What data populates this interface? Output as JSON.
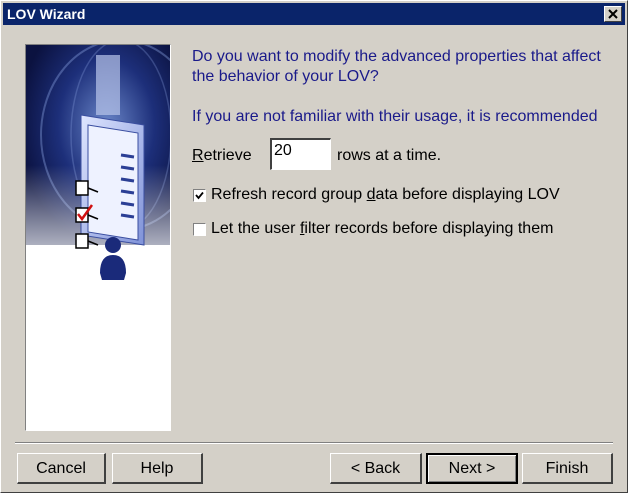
{
  "window": {
    "title": "LOV Wizard"
  },
  "question": {
    "line1": "Do you want to modify the advanced properties that affect the behavior of your LOV?",
    "line2": "If you are not familiar with their usage, it is recommended"
  },
  "retrieve": {
    "label_mnemonic": "R",
    "label_rest": "etrieve",
    "value": "20",
    "suffix": "rows at a time."
  },
  "options": {
    "refresh": {
      "before": "Refresh record group ",
      "mnemonic": "d",
      "after": "ata before displaying LOV",
      "checked": true
    },
    "filter": {
      "before": "Let the user ",
      "mnemonic": "f",
      "after": "ilter records before displaying them",
      "checked": false
    }
  },
  "buttons": {
    "cancel": "Cancel",
    "help": "Help",
    "back": "< Back",
    "next": "Next >",
    "finish": "Finish"
  },
  "colors": {
    "titlebar": "#0a246a",
    "question_text": "#1a1a8a",
    "dialog_bg": "#d4d0c8"
  }
}
